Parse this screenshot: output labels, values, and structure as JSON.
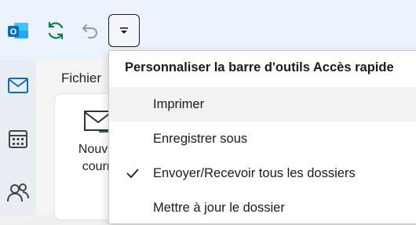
{
  "quick_access_toolbar": {
    "icons": [
      "outlook-logo-icon",
      "sync-icon",
      "undo-icon",
      "customize-toolbar-icon"
    ]
  },
  "left_rail": {
    "icons": [
      "mail-icon",
      "calendar-icon",
      "people-icon"
    ]
  },
  "ribbon": {
    "file_tab": "Fichier",
    "new_mail_label": "Nouve\ncourr"
  },
  "customize_menu": {
    "title": "Personnaliser la barre d'outils Accès rapide",
    "items": [
      {
        "label": "Imprimer",
        "checked": false
      },
      {
        "label": "Enregistrer sous",
        "checked": false
      },
      {
        "label": "Envoyer/Recevoir tous les dossiers",
        "checked": true
      },
      {
        "label": "Mettre à jour le dossier",
        "checked": false
      }
    ]
  },
  "colors": {
    "outlook_blue": "#0f6cbd",
    "sync_green": "#107c41",
    "disabled_gray": "#9a9a9a"
  }
}
